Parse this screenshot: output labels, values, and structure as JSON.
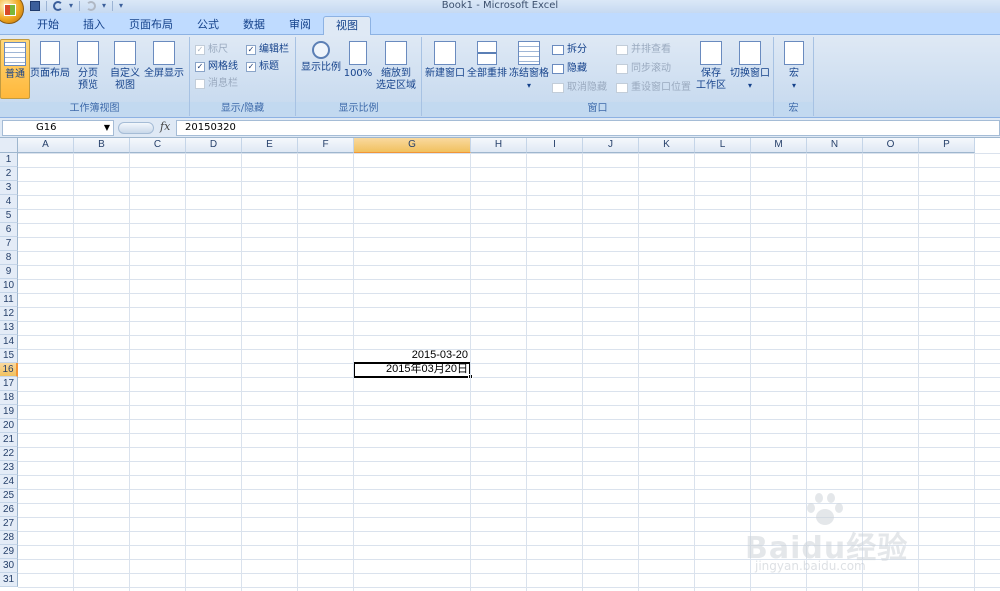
{
  "window": {
    "title": "Book1 - Microsoft Excel"
  },
  "tabs": [
    {
      "label": "开始",
      "active": false
    },
    {
      "label": "插入",
      "active": false
    },
    {
      "label": "页面布局",
      "active": false
    },
    {
      "label": "公式",
      "active": false
    },
    {
      "label": "数据",
      "active": false
    },
    {
      "label": "审阅",
      "active": false
    },
    {
      "label": "视图",
      "active": true
    }
  ],
  "ribbon": {
    "workbook_views": {
      "label": "工作簿视图",
      "normal": "普通",
      "page_layout": "页面布局",
      "page_break_1": "分页",
      "page_break_2": "预览",
      "custom_1": "自定义",
      "custom_2": "视图",
      "full_screen": "全屏显示"
    },
    "show_hide": {
      "label": "显示/隐藏",
      "ruler": "标尺",
      "gridlines": "网格线",
      "message_bar": "消息栏",
      "formula_bar": "编辑栏",
      "headings": "标题"
    },
    "zoom": {
      "label": "显示比例",
      "zoom": "显示比例",
      "zoom100": "100%",
      "zoom_selection_1": "缩放到",
      "zoom_selection_2": "选定区域"
    },
    "window": {
      "label": "窗口",
      "new_window": "新建窗口",
      "arrange_all": "全部重排",
      "freeze_panes": "冻结窗格",
      "split": "拆分",
      "hide": "隐藏",
      "unhide": "取消隐藏",
      "side_by_side": "并排查看",
      "sync_scroll": "同步滚动",
      "reset_position": "重设窗口位置",
      "save_workspace_1": "保存",
      "save_workspace_2": "工作区",
      "switch_windows": "切换窗口"
    },
    "macros": {
      "label": "宏",
      "macros": "宏"
    }
  },
  "formula_bar": {
    "name_box": "G16",
    "fx": "fx",
    "formula": "20150320"
  },
  "columns": [
    "A",
    "B",
    "C",
    "D",
    "E",
    "F",
    "G",
    "H",
    "I",
    "J",
    "K",
    "L",
    "M",
    "N",
    "O",
    "P"
  ],
  "selected_column": "G",
  "rows": [
    1,
    2,
    3,
    4,
    5,
    6,
    7,
    8,
    9,
    10,
    11,
    12,
    13,
    14,
    15,
    16,
    17,
    18,
    19,
    20,
    21,
    22,
    23,
    24,
    25,
    26,
    27,
    28,
    29,
    30,
    31
  ],
  "selected_row": 16,
  "cells": {
    "G15": "2015-03-20",
    "G16": "2015年03月20日"
  },
  "watermark": {
    "brand": "Baidu经验",
    "url": "jingyan.baidu.com"
  },
  "colors": {
    "accent": "#f29536",
    "ribbon_bg": "#dfe9f5",
    "tab_bar": "#bfdbff"
  }
}
